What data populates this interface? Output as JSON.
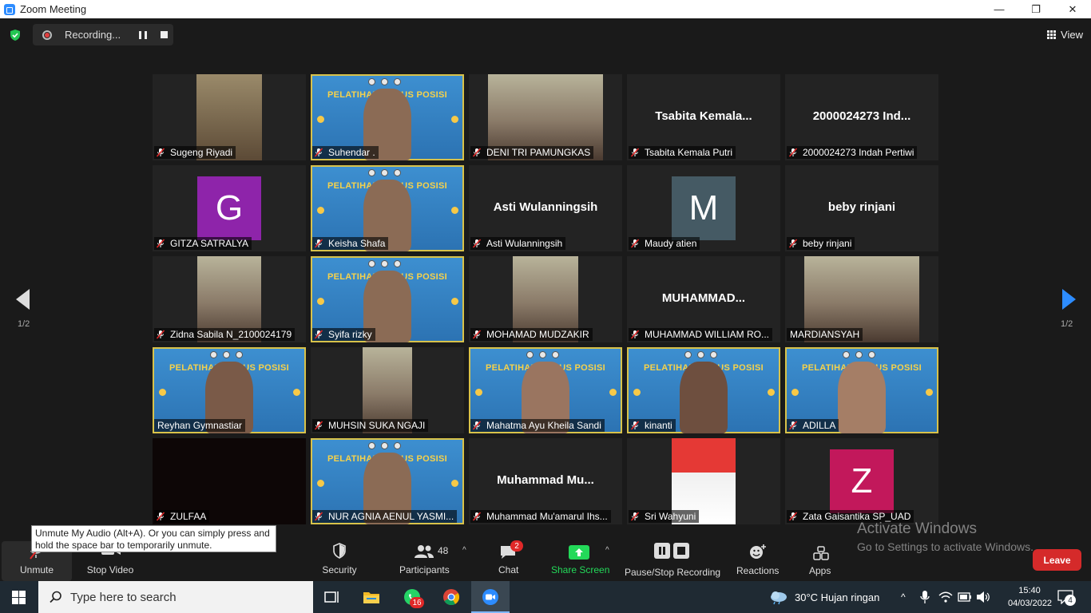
{
  "window": {
    "title": "Zoom Meeting",
    "minimize": "—",
    "maximize": "❐",
    "close": "✕"
  },
  "topbar": {
    "recording_label": "Recording...",
    "view_label": "View"
  },
  "gallery": {
    "page_left": "1/2",
    "page_right": "1/2",
    "tiles": [
      {
        "name": "Sugeng Riyadi",
        "muted": true
      },
      {
        "name": "Suhendar .",
        "muted": true,
        "banner": "PELATIHAN KASUS POSISI"
      },
      {
        "name": "DENI TRI PAMUNGKAS",
        "muted": true
      },
      {
        "name": "Tsabita Kemala Putri",
        "center": "Tsabita  Kemala...",
        "muted": true
      },
      {
        "name": "2000024273 Indah Pertiwi",
        "center": "2000024273  Ind...",
        "muted": true
      },
      {
        "name": "GITZA SATRALYA",
        "avatar": "G",
        "avatar_color": "#8e24aa",
        "muted": true
      },
      {
        "name": "Keisha Shafa",
        "muted": true,
        "banner": "PELATIHAN KASUS POSISI"
      },
      {
        "name": "Asti Wulanningsih",
        "center": "Asti Wulanningsih",
        "muted": true
      },
      {
        "name": "Maudy atien",
        "avatar": "M",
        "avatar_color": "#455a64",
        "muted": true
      },
      {
        "name": "beby rinjani",
        "center": "beby rinjani",
        "muted": true
      },
      {
        "name": "Zidna Sabila N_2100024179",
        "muted": true
      },
      {
        "name": "Syifa rizky",
        "muted": true,
        "banner": "PELATIHAN KASUS POSISI"
      },
      {
        "name": "MOHAMAD MUDZAKIR",
        "muted": true
      },
      {
        "name": "MUHAMMAD WILLIAM RO...",
        "center": "MUHAMMAD...",
        "muted": true
      },
      {
        "name": "MARDIANSYAH",
        "muted": false
      },
      {
        "name": "Reyhan Gymnastiar",
        "muted": false,
        "active": true,
        "banner": "PELATIHAN KASUS POSISI"
      },
      {
        "name": "MUHSIN SUKA NGAJI",
        "muted": true
      },
      {
        "name": "Mahatma Ayu Kheila Sandi",
        "muted": true,
        "banner": "PELATIHAN KASUS POSISI"
      },
      {
        "name": "kinanti",
        "muted": true,
        "banner": "PELATIHAN KASUS POSISI"
      },
      {
        "name": "ADILLA",
        "muted": true,
        "banner": "PELATIHAN KASUS POSISI"
      },
      {
        "name": "ZULFAA",
        "muted": true
      },
      {
        "name": "NUR AGNIA AENUL YASMI...",
        "muted": true,
        "banner": "PELATIHAN KASUS POSISI"
      },
      {
        "name": "Muhammad Mu'amarul Ihs...",
        "center": "Muhammad  Mu...",
        "muted": true
      },
      {
        "name": "Sri Wahyuni",
        "muted": true
      },
      {
        "name": "Zata Gaisantika SP_UAD",
        "avatar": "Z",
        "avatar_color": "#c2185b",
        "muted": true
      }
    ]
  },
  "toolbar": {
    "unmute": "Unmute",
    "stop_video": "Stop Video",
    "security": "Security",
    "participants": "Participants",
    "participants_count": "48",
    "chat": "Chat",
    "chat_badge": "2",
    "share_screen": "Share Screen",
    "pause_recording": "Pause/Stop Recording",
    "reactions": "Reactions",
    "apps": "Apps",
    "leave": "Leave",
    "tooltip": "Unmute My Audio (Alt+A). Or you can simply press and hold the space bar to temporarily unmute."
  },
  "watermark": {
    "line1": "Activate Windows",
    "line2": "Go to Settings to activate Windows."
  },
  "taskbar": {
    "search_placeholder": "Type here to search",
    "whatsapp_badge": "16",
    "weather": "30°C  Hujan ringan",
    "time": "15:40",
    "date": "04/03/2022",
    "notifications": "4"
  },
  "colors": {
    "accent": "#2d8cff",
    "leave": "#d52a2a",
    "share": "#23d959",
    "active_speaker": "#c6e43b"
  }
}
